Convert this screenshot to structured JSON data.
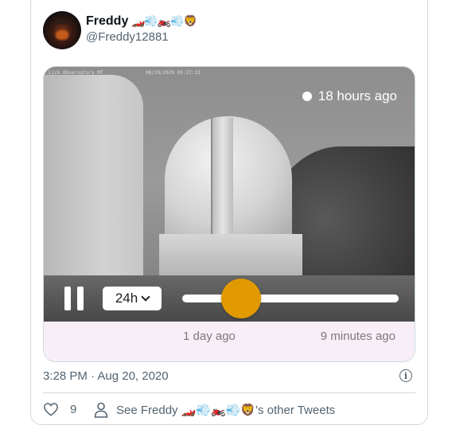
{
  "tweet": {
    "author_name": "Freddy",
    "author_emojis": "🏎️💨🏍️💨🦁",
    "author_handle": "@Freddy12881",
    "posted_time": "3:28 PM · Aug 20, 2020",
    "like_count": "9",
    "other_tweets_prefix": "See Freddy",
    "other_tweets_emojis": "🏎️💨🏍️💨🦁",
    "other_tweets_suffix": "'s other Tweets"
  },
  "media": {
    "cam_label": "Lick Observatory MT",
    "cam_datetime": "08/19/2020 05:27:33",
    "timestamp_label": "18 hours ago",
    "range_label": "24h",
    "scrub_start_label": "1 day ago",
    "scrub_end_label": "9 minutes ago",
    "scrub_position": 0.2,
    "accent_color": "#e09a00",
    "panel_color": "#f8eef8"
  },
  "icons": {
    "pause": "pause-icon",
    "chevron": "chevron-down-icon",
    "heart": "heart-icon",
    "person": "person-icon",
    "info": "info-icon"
  }
}
